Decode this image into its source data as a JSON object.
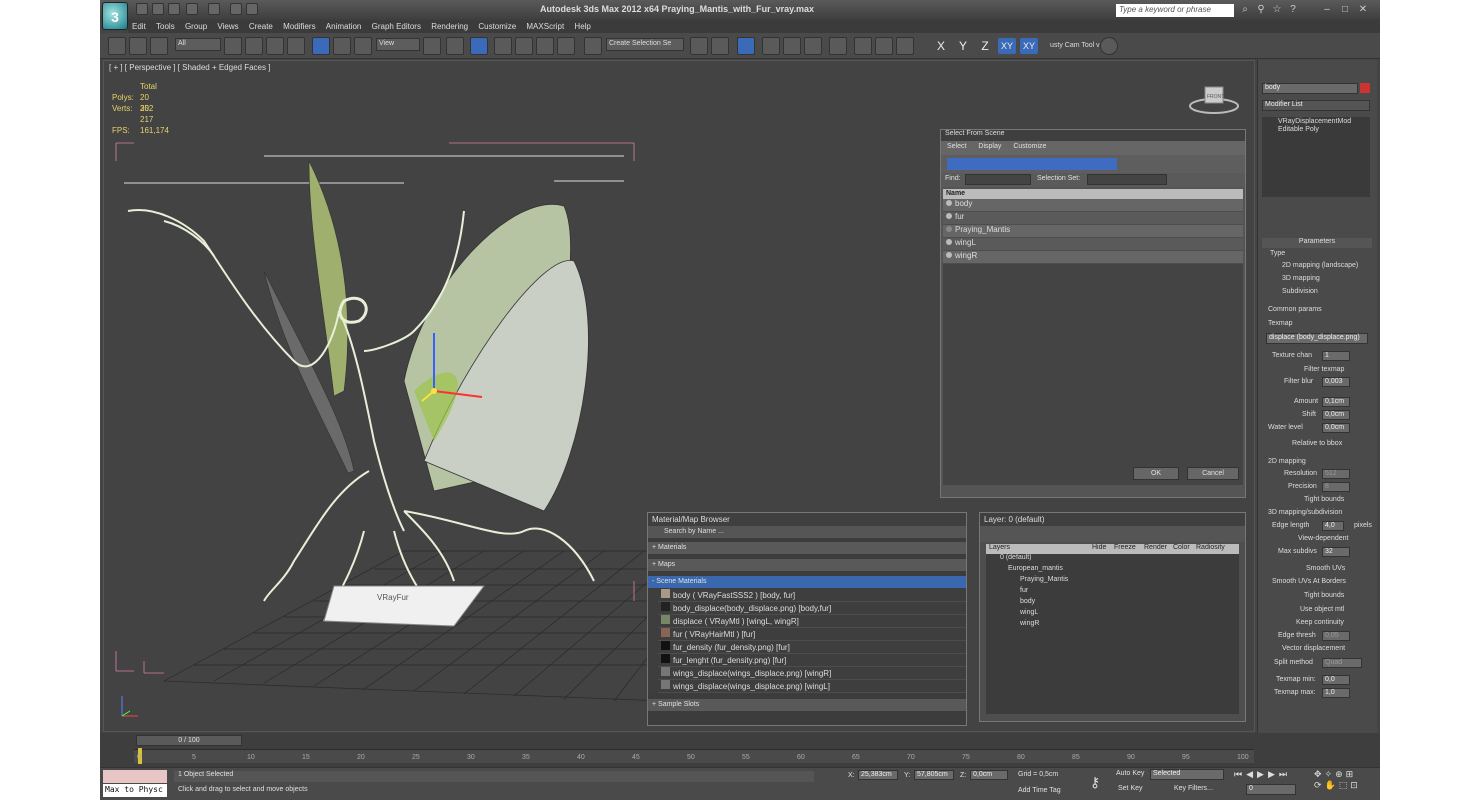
{
  "titlebar": {
    "title": "Autodesk 3ds Max  2012 x64      Praying_Mantis_with_Fur_vray.max",
    "search_placeholder": "Type a keyword or phrase"
  },
  "menu": [
    "Edit",
    "Tools",
    "Group",
    "Views",
    "Create",
    "Modifiers",
    "Animation",
    "Graph Editors",
    "Rendering",
    "Customize",
    "MAXScript",
    "Help"
  ],
  "toolbar": {
    "filter": "All",
    "view": "View",
    "named_sel": "Create Selection Se",
    "axes": [
      "X",
      "Y",
      "Z",
      "XY",
      "XY"
    ],
    "tool_label": "usty Cam Tool v"
  },
  "viewport": {
    "label": "[ + ] [ Perspective ] [ Shaded + Edged Faces ]",
    "stats_header": "Total",
    "polys_label": "Polys:",
    "polys": "20 352",
    "verts_label": "Verts:",
    "verts": "20 217",
    "fps_label": "FPS:",
    "fps": "161,174",
    "mesh_text": "VRayFur",
    "viewcube": "FRONT"
  },
  "select_scene": {
    "title": "Select From Scene",
    "tabs": [
      "Select",
      "Display",
      "Customize"
    ],
    "find_label": "Find:",
    "selset_label": "Selection Set:",
    "col_name": "Name",
    "items": [
      "body",
      "fur",
      "Praying_Mantis",
      "wingL",
      "wingR"
    ],
    "ok": "OK",
    "cancel": "Cancel"
  },
  "material_browser": {
    "title": "Material/Map Browser",
    "search": "Search by Name ...",
    "sections": {
      "materials": "+ Materials",
      "maps": "+ Maps",
      "scene": "- Scene Materials",
      "sample": "+ Sample Slots"
    },
    "items": [
      "body  ( VRayFastSSS2 )  [body, fur]",
      "body_displace(body_displace.png) [body,fur]",
      "displace  ( VRayMtl )  [wingL, wingR]",
      "fur  ( VRayHairMtl )  [fur]",
      "fur_density (fur_density.png)  [fur]",
      "fur_lenght (fur_density.png)  [fur]",
      "wings_displace(wings_displace.png) [wingR]",
      "wings_displace(wings_displace.png) [wingL]"
    ]
  },
  "layer_manager": {
    "title": "Layer: 0 (default)",
    "cols": [
      "Layers",
      "Hide",
      "Freeze",
      "Render",
      "Color",
      "Radiosity"
    ],
    "rows": [
      "0 (default)",
      "European_mantis",
      "Praying_Mantis",
      "fur",
      "body",
      "wingL",
      "wingR"
    ]
  },
  "command_panel": {
    "object_name": "body",
    "modifier_list": "Modifier List",
    "stack": [
      "VRayDisplacementMod",
      "Editable Poly"
    ],
    "params_title": "Parameters",
    "type_label": "Type",
    "types": [
      "2D mapping (landscape)",
      "3D mapping",
      "Subdivision"
    ],
    "common": "Common params",
    "texmap": "Texmap",
    "texmap_val": "displace (body_displace.png)",
    "texture_chan": "Texture chan",
    "texture_chan_val": "1",
    "filter_texmap": "Filter texmap",
    "filter_blur": "Filter blur",
    "filter_blur_val": "0,003",
    "amount": "Amount",
    "amount_val": "0,1cm",
    "shift": "Shift",
    "shift_val": "0,0cm",
    "water": "Water level",
    "water_val": "0,0cm",
    "relative": "Relative to bbox",
    "mapping2d": "2D mapping",
    "resolution": "Resolution",
    "resolution_val": "512",
    "precision": "Precision",
    "precision_val": "8",
    "tight": "Tight bounds",
    "mapping3d": "3D mapping/subdivision",
    "edge_len": "Edge length",
    "edge_len_val": "4,0",
    "pixels": "pixels",
    "view_dep": "View-dependent",
    "max_subdivs": "Max subdivs",
    "max_subdivs_val": "32",
    "smooth_uvs": "Smooth UVs",
    "smooth_border": "Smooth UVs At Borders",
    "tight2": "Tight bounds",
    "use_obj": "Use object mtl",
    "keep": "Keep continuity",
    "edge_thresh": "Edge thresh",
    "edge_thresh_val": "0,05",
    "vector": "Vector displacement",
    "split": "Split method",
    "split_val": "Quad",
    "tex_min": "Texmap min:",
    "tex_min_val": "0,0",
    "tex_max": "Texmap max:",
    "tex_max_val": "1,0"
  },
  "timeline": {
    "frame": "0 / 100",
    "ticks": [
      "0",
      "5",
      "10",
      "15",
      "20",
      "25",
      "30",
      "35",
      "40",
      "45",
      "50",
      "55",
      "60",
      "65",
      "70",
      "75",
      "80",
      "85",
      "90",
      "95",
      "100"
    ]
  },
  "status": {
    "script": "Max to Physc",
    "selected": "1 Object Selected",
    "hint": "Click and drag to select and move objects",
    "x_label": "X:",
    "x_val": "25,383cm",
    "y_label": "Y:",
    "y_val": "57,805cm",
    "z_label": "Z:",
    "z_val": "0,0cm",
    "grid": "Grid = 0,5cm",
    "add_tag": "Add Time Tag",
    "auto_key": "Auto Key",
    "set_key": "Set Key",
    "selected_dd": "Selected",
    "key_filters": "Key Filters...",
    "frame_val": "0"
  }
}
